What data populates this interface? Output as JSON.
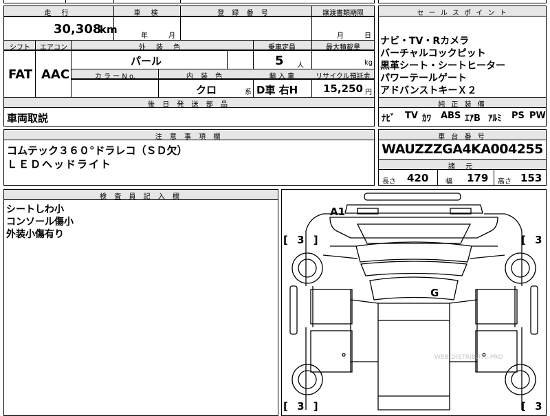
{
  "top_strip": {
    "left_cut": "",
    "middle_cut": ""
  },
  "row1": {
    "mileage_label": "走 行",
    "mileage_value": "30,308",
    "mileage_unit": "km",
    "inspection_label": "車 検",
    "inspection_year": "年",
    "inspection_month": "月",
    "registration_label": "登 録 番 号",
    "registration_value": "",
    "transfer_label": "譲渡書類期限",
    "transfer_month": "月",
    "transfer_day": "日"
  },
  "row2": {
    "shift_label": "シフト",
    "shift_value": "FAT",
    "ac_label": "エアコン",
    "ac_value": "AAC",
    "exterior_color_label": "外 装 色",
    "exterior_color_value": "パール",
    "capacity_label": "乗車定員",
    "capacity_value": "5",
    "capacity_unit": "人",
    "max_load_label": "最大積載量",
    "max_load_unit": "kg",
    "color_no_label": "カ ラ ー N o.",
    "color_no_value": "",
    "interior_color_label": "内 装 色",
    "interior_color_value": "クロ",
    "interior_color_suffix": "系",
    "import_label": "輸 入 車",
    "import_value": "D車 右H",
    "recycle_label": "リサイクル預託金",
    "recycle_value": "15,250",
    "recycle_unit": "円"
  },
  "sales_points": {
    "title": "セ ー ル ス ポ イ ン ト",
    "items": [
      "ナビ・TV・Rカメラ",
      "バーチャルコックピット",
      "黒革シート・シートヒーター",
      "パワーテールゲート",
      "アドバンストキーＸ２"
    ]
  },
  "genuine_equipment": {
    "title": "純 正 装 備",
    "items": [
      "ﾅﾋﾞ",
      "TV",
      "ｶﾜ",
      "ABS",
      "ｴｱB",
      "ｱﾙﾐ",
      "PS",
      "PW"
    ]
  },
  "later_parts": {
    "title": "後 日 発 送 部 品",
    "value": "車両取説"
  },
  "notes": {
    "title": "注 意 事 項 欄",
    "lines": [
      "コムテック３６０°ドラレコ（ＳＤ欠）",
      "ＬＥＤヘッドライト"
    ]
  },
  "vin": {
    "title": "車 台 番 号",
    "value": "WAUZZZGA4KA004255"
  },
  "specs": {
    "title": "諸 元",
    "length_label": "長さ",
    "length_value": "420",
    "width_label": "幅",
    "width_value": "179",
    "height_label": "高さ",
    "height_value": "153"
  },
  "inspector": {
    "title": "検 査 員 記 入 欄",
    "lines": [
      "シートしわ小",
      "コンソール傷小",
      "外装小傷有り"
    ]
  },
  "diagram": {
    "mark_a1": "A1",
    "mark_g": "G",
    "tire_tl": "[ 3 ]",
    "tire_tr": "[ 3 ]",
    "tire_bl": "[ 3 ]",
    "tire_br": "[ 3 ]",
    "watermark": "WEB-DISTRIBUTE-PRO"
  }
}
